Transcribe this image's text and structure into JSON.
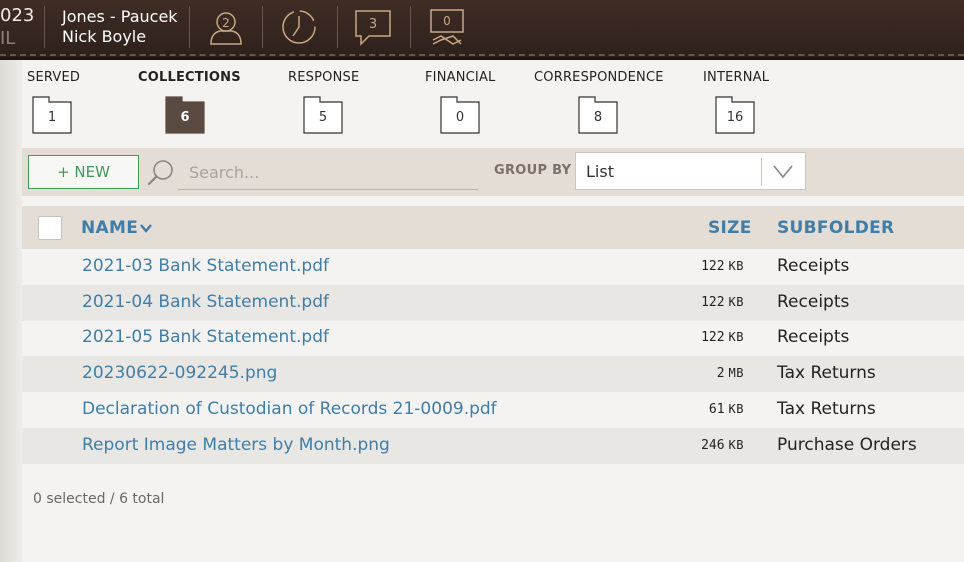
{
  "header": {
    "case_number": "023",
    "case_location": "IL",
    "party_primary": "Jones - Paucek",
    "party_secondary": "Nick Boyle",
    "icons": [
      {
        "name": "user-icon",
        "count": "2"
      },
      {
        "name": "clock-icon",
        "count": ""
      },
      {
        "name": "message-icon",
        "count": "3"
      },
      {
        "name": "link-icon",
        "count": "0"
      }
    ]
  },
  "categories": [
    {
      "label": "SERVED",
      "count": "1",
      "active": false
    },
    {
      "label": "COLLECTIONS",
      "count": "6",
      "active": true
    },
    {
      "label": "RESPONSE",
      "count": "5",
      "active": false
    },
    {
      "label": "FINANCIAL",
      "count": "0",
      "active": false
    },
    {
      "label": "CORRESPONDENCE",
      "count": "8",
      "active": false
    },
    {
      "label": "INTERNAL",
      "count": "16",
      "active": false
    }
  ],
  "toolbar": {
    "new_label": "+ NEW",
    "search_placeholder": "Search...",
    "groupby_label": "GROUP BY",
    "groupby_value": "List"
  },
  "table": {
    "columns": {
      "name": "NAME",
      "size": "SIZE",
      "subfolder": "SUBFOLDER"
    },
    "rows": [
      {
        "name": "2021-03 Bank Statement.pdf",
        "size": "122",
        "unit": "KB",
        "subfolder": "Receipts"
      },
      {
        "name": "2021-04 Bank Statement.pdf",
        "size": "122",
        "unit": "KB",
        "subfolder": "Receipts"
      },
      {
        "name": "2021-05 Bank Statement.pdf",
        "size": "122",
        "unit": "KB",
        "subfolder": "Receipts"
      },
      {
        "name": "20230622-092245.png",
        "size": "2",
        "unit": "MB",
        "subfolder": "Tax Returns"
      },
      {
        "name": "Declaration of Custodian of Records 21-0009.pdf",
        "size": "61",
        "unit": "KB",
        "subfolder": "Tax Returns"
      },
      {
        "name": "Report Image Matters by Month.png",
        "size": "246",
        "unit": "KB",
        "subfolder": "Purchase Orders"
      }
    ]
  },
  "footer": {
    "selection_status": "0 selected / 6 total"
  },
  "colors": {
    "accent": "#3f7ea8",
    "new_button": "#3f9b57",
    "active_folder": "#5a4a42",
    "leather": "#3a2a23"
  }
}
